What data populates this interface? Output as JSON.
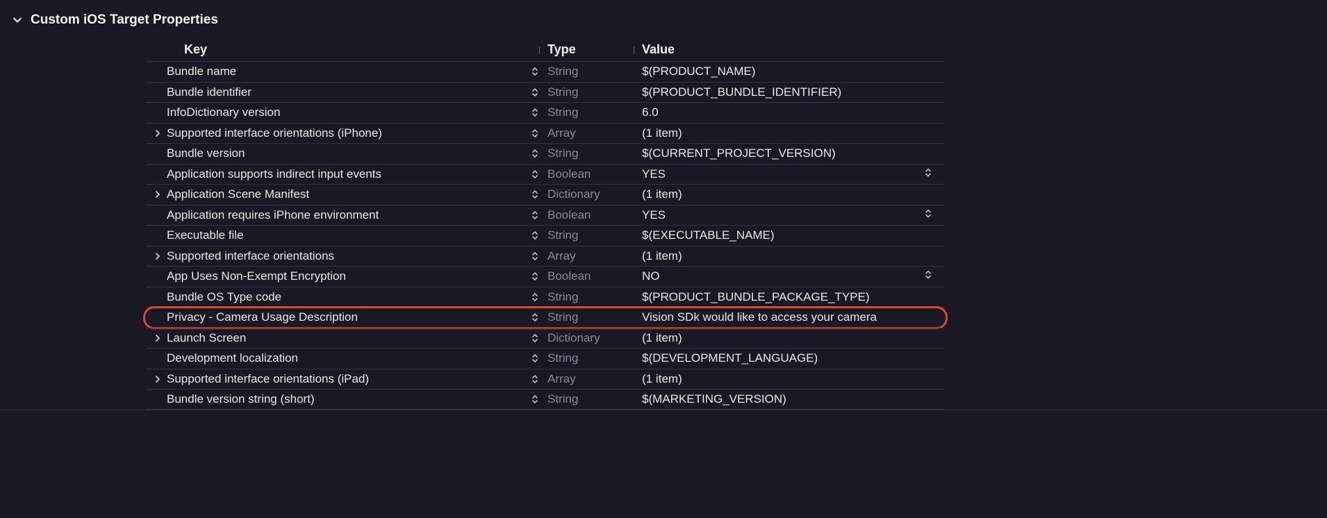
{
  "section": {
    "title": "Custom iOS Target Properties"
  },
  "columns": {
    "key": "Key",
    "type": "Type",
    "value": "Value"
  },
  "rows": [
    {
      "key": "Bundle name",
      "type": "String",
      "value": "$(PRODUCT_NAME)",
      "expandable": false,
      "bool": false
    },
    {
      "key": "Bundle identifier",
      "type": "String",
      "value": "$(PRODUCT_BUNDLE_IDENTIFIER)",
      "expandable": false,
      "bool": false
    },
    {
      "key": "InfoDictionary version",
      "type": "String",
      "value": "6.0",
      "expandable": false,
      "bool": false
    },
    {
      "key": "Supported interface orientations (iPhone)",
      "type": "Array",
      "value": "(1 item)",
      "expandable": true,
      "bool": false
    },
    {
      "key": "Bundle version",
      "type": "String",
      "value": "$(CURRENT_PROJECT_VERSION)",
      "expandable": false,
      "bool": false
    },
    {
      "key": "Application supports indirect input events",
      "type": "Boolean",
      "value": "YES",
      "expandable": false,
      "bool": true
    },
    {
      "key": "Application Scene Manifest",
      "type": "Dictionary",
      "value": "(1 item)",
      "expandable": true,
      "bool": false
    },
    {
      "key": "Application requires iPhone environment",
      "type": "Boolean",
      "value": "YES",
      "expandable": false,
      "bool": true
    },
    {
      "key": "Executable file",
      "type": "String",
      "value": "$(EXECUTABLE_NAME)",
      "expandable": false,
      "bool": false
    },
    {
      "key": "Supported interface orientations",
      "type": "Array",
      "value": "(1 item)",
      "expandable": true,
      "bool": false
    },
    {
      "key": "App Uses Non-Exempt Encryption",
      "type": "Boolean",
      "value": "NO",
      "expandable": false,
      "bool": true
    },
    {
      "key": "Bundle OS Type code",
      "type": "String",
      "value": "$(PRODUCT_BUNDLE_PACKAGE_TYPE)",
      "expandable": false,
      "bool": false
    },
    {
      "key": "Privacy - Camera Usage Description",
      "type": "String",
      "value": "Vision SDk would like to access your camera",
      "expandable": false,
      "bool": false,
      "highlight": true
    },
    {
      "key": "Launch Screen",
      "type": "Dictionary",
      "value": "(1 item)",
      "expandable": true,
      "bool": false
    },
    {
      "key": "Development localization",
      "type": "String",
      "value": "$(DEVELOPMENT_LANGUAGE)",
      "expandable": false,
      "bool": false
    },
    {
      "key": "Supported interface orientations (iPad)",
      "type": "Array",
      "value": "(1 item)",
      "expandable": true,
      "bool": false
    },
    {
      "key": "Bundle version string (short)",
      "type": "String",
      "value": "$(MARKETING_VERSION)",
      "expandable": false,
      "bool": false
    }
  ]
}
